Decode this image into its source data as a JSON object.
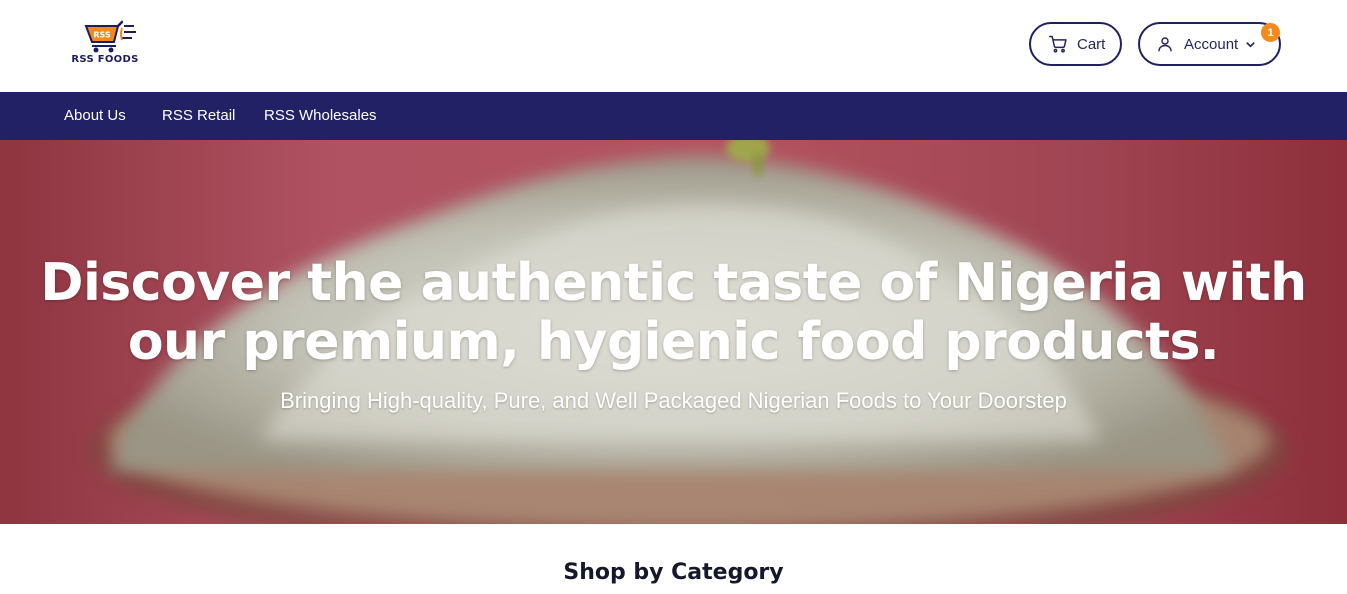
{
  "brand": {
    "name": "RSS FOODS",
    "badge_text": "RSS",
    "colors": {
      "navy": "#222165",
      "orange": "#f28a1e"
    }
  },
  "header": {
    "cart": {
      "label": "Cart",
      "icon": "cart-icon"
    },
    "account": {
      "label": "Account",
      "icon": "user-icon",
      "badge_count": "1"
    }
  },
  "nav": {
    "items": [
      "About Us",
      "RSS Retail",
      "RSS Wholesales"
    ]
  },
  "hero": {
    "title": "Discover the authentic taste of Nigeria with our premium, hygienic food products.",
    "subtitle": "Bringing High-quality, Pure, and Well Packaged Nigerian Foods to Your Doorstep"
  },
  "sections": {
    "category_title": "Shop by Category"
  }
}
